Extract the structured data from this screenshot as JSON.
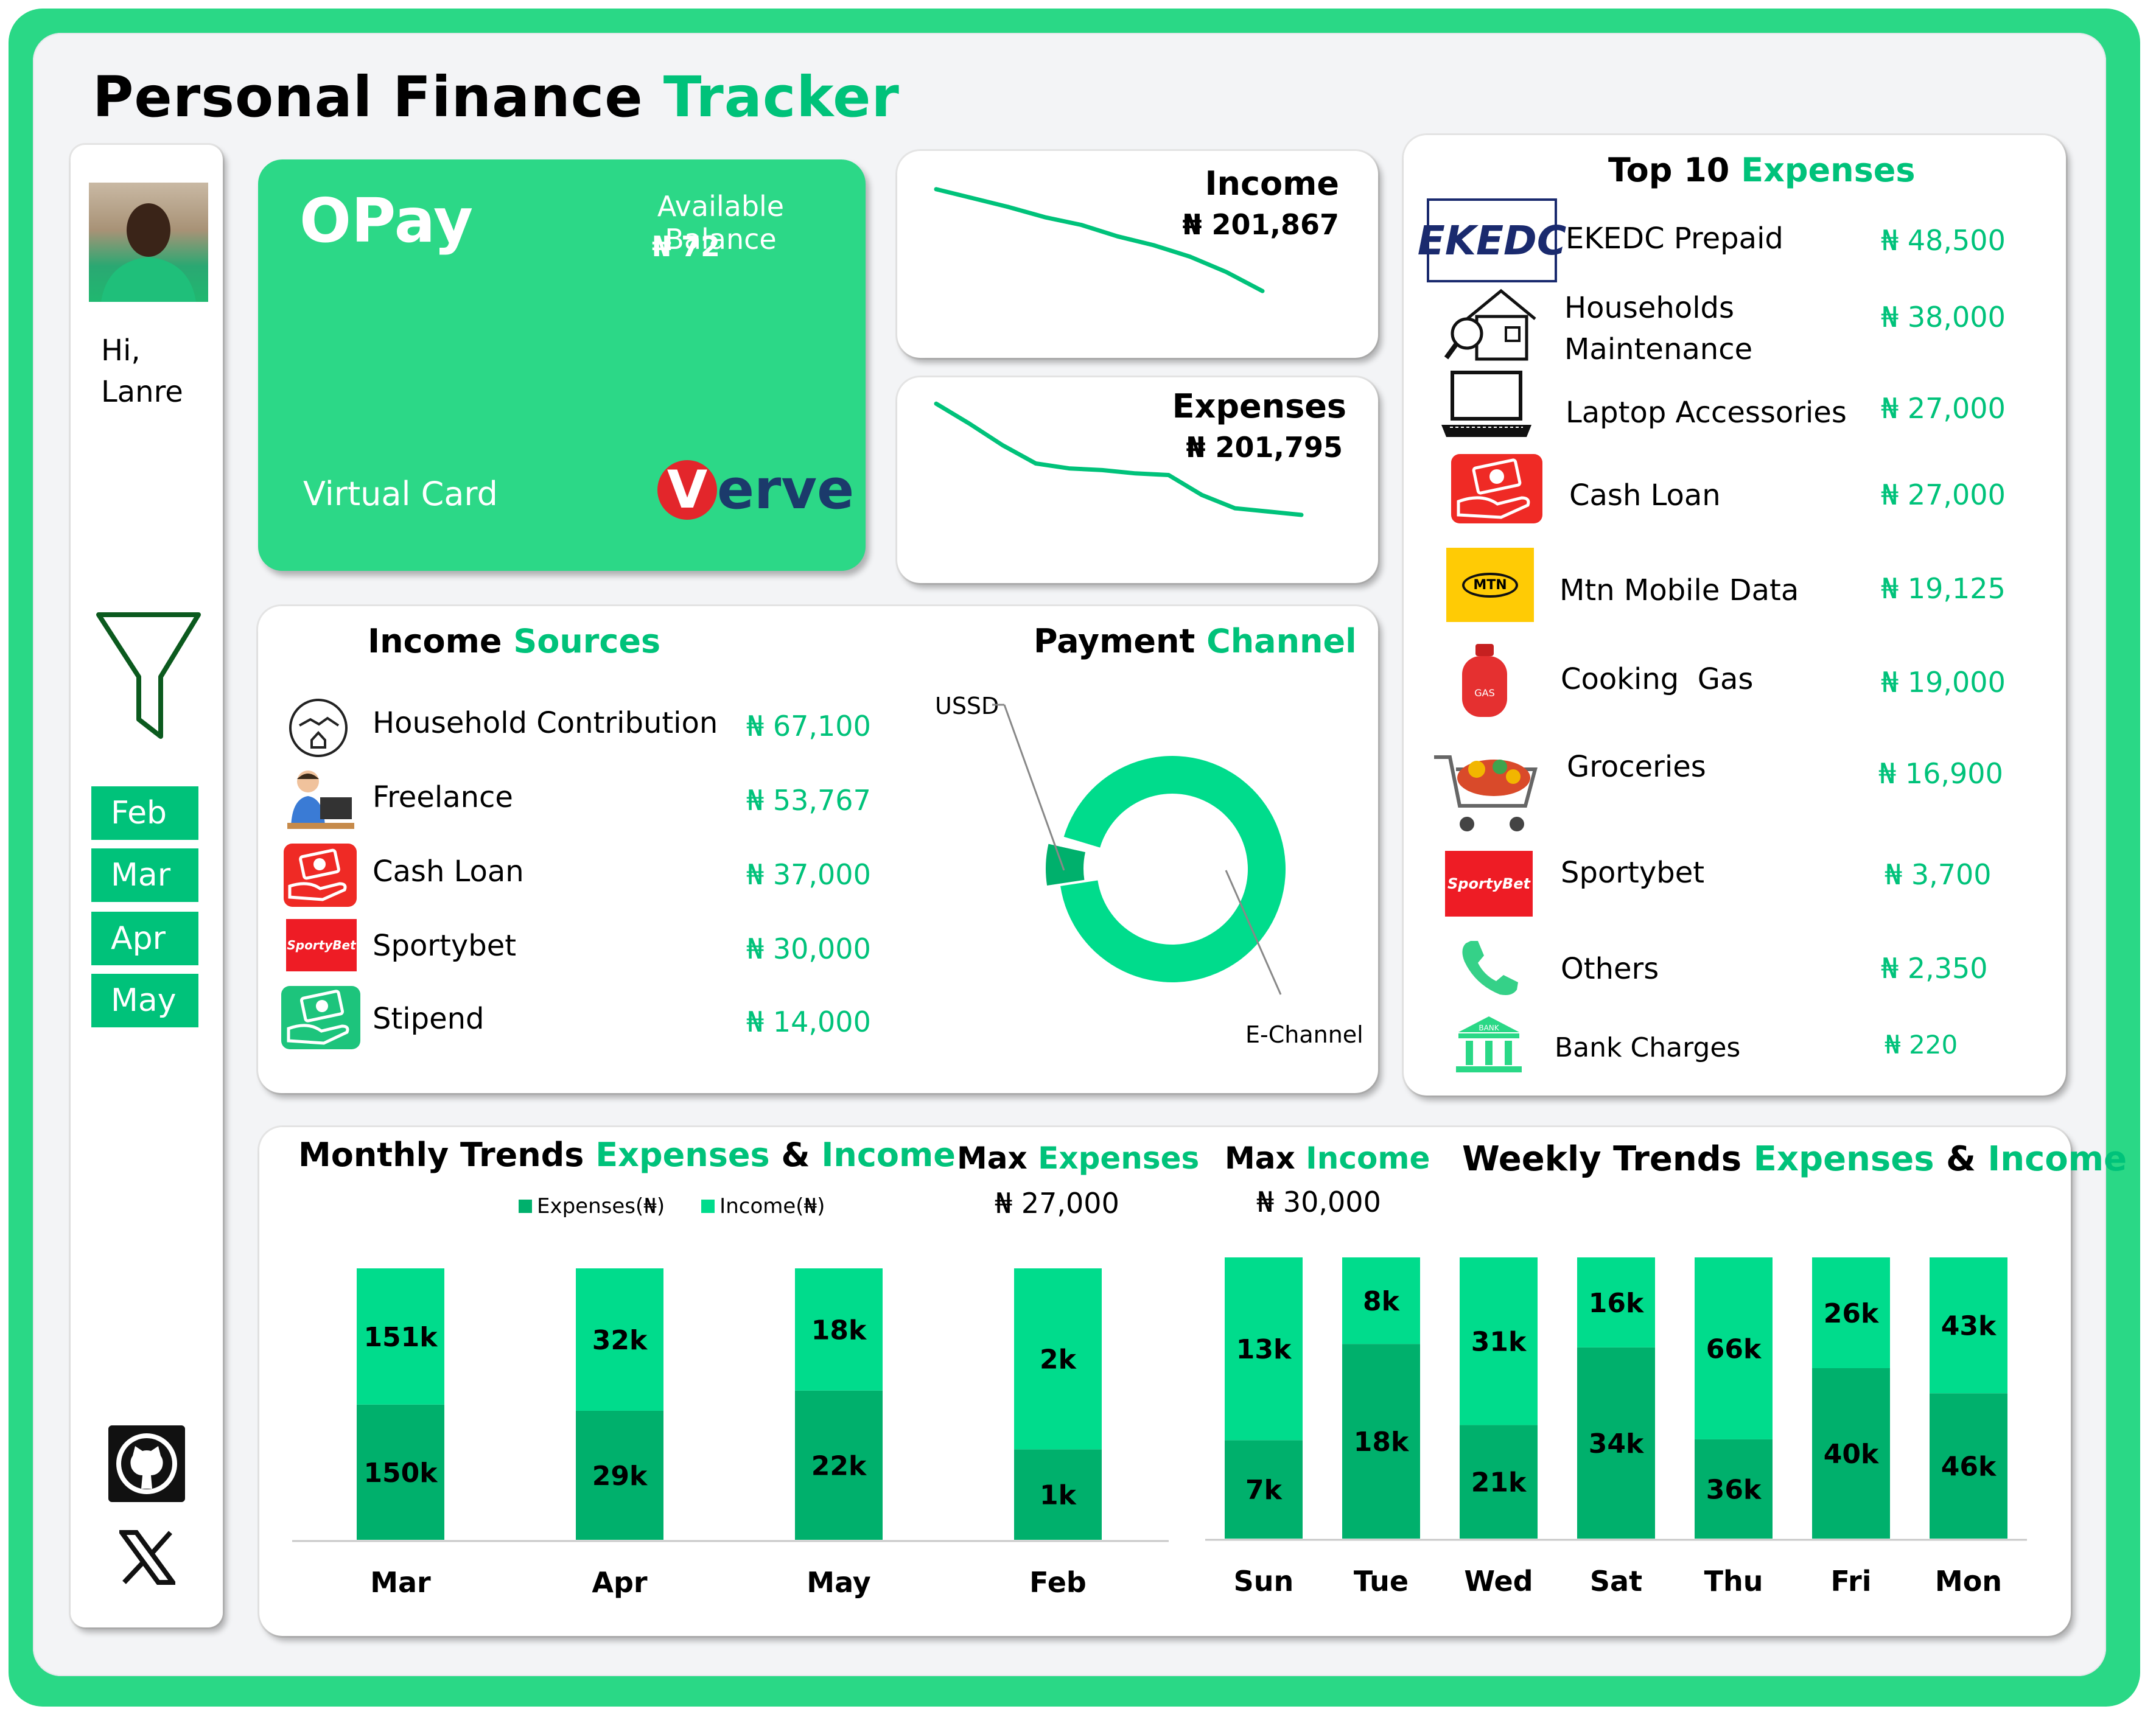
{
  "page_title": {
    "part1": "Personal Finance",
    "part2": "Tracker"
  },
  "sidebar": {
    "greeting_hi": "Hi,",
    "greeting_name": "Lanre",
    "months": [
      "Feb",
      "Mar",
      "Apr",
      "May"
    ]
  },
  "card": {
    "brand": "OPay",
    "balance_label": "Available Balance",
    "balance_value": "₦ 72",
    "card_type": "Virtual Card",
    "network": "Verve",
    "network_first": "V",
    "network_rest": "erve"
  },
  "income_kpi": {
    "label": "Income",
    "value": "₦ 201,867"
  },
  "expenses_kpi": {
    "label": "Expenses",
    "value": "₦ 201,795"
  },
  "income_sources": {
    "title1": "Income",
    "title2": "Sources",
    "items": [
      {
        "label": "Household Contribution",
        "value": "₦ 67,100",
        "icon": "handshake-house-icon"
      },
      {
        "label": "Freelance",
        "value": "₦ 53,767",
        "icon": "computer-worker-icon"
      },
      {
        "label": "Cash Loan",
        "value": "₦ 37,000",
        "icon": "cash-hand-icon"
      },
      {
        "label": "Sportybet",
        "value": "₦ 30,000",
        "icon": "sportybet-logo"
      },
      {
        "label": "Stipend",
        "value": "₦ 14,000",
        "icon": "money-hand-icon"
      }
    ]
  },
  "payment_channel": {
    "title1": "Payment",
    "title2": "Channel",
    "labels": {
      "ussd": "USSD",
      "echannel": "E-Channel"
    },
    "colors": {
      "echannel": "#00dc8c",
      "ussd": "#00b06c"
    }
  },
  "top_expenses": {
    "title1": "Top 10",
    "title2": "Expenses",
    "items": [
      {
        "label": "EKEDC Prepaid",
        "value": "₦ 48,500",
        "icon": "ekedc-logo",
        "logo_text": "EKEDC"
      },
      {
        "label": "Households",
        "label2": "Maintenance",
        "value": "₦ 38,000",
        "icon": "house-search-icon"
      },
      {
        "label": "Laptop Accessories",
        "value": "₦ 27,000",
        "icon": "laptop-icon"
      },
      {
        "label": "Cash Loan",
        "value": "₦ 27,000",
        "icon": "cash-hand-icon"
      },
      {
        "label": "Mtn Mobile Data",
        "value": "₦ 19,125",
        "icon": "mtn-logo",
        "logo_text": "MTN"
      },
      {
        "label": "Cooking  Gas",
        "value": "₦ 19,000",
        "icon": "gas-cylinder-icon"
      },
      {
        "label": "Groceries",
        "value": "₦ 16,900",
        "icon": "shopping-cart-icon"
      },
      {
        "label": "Sportybet",
        "value": "₦ 3,700",
        "icon": "sportybet-logo"
      },
      {
        "label": "Others",
        "value": "₦ 2,350",
        "icon": "phone-icon"
      },
      {
        "label": "Bank Charges",
        "value": "₦ 220",
        "icon": "bank-icon"
      }
    ]
  },
  "logo_texts": {
    "sportybet": "SportyBet",
    "gas": "GAS",
    "bank": "BANK"
  },
  "monthly": {
    "title1": "Monthly Trends",
    "title2": "Expenses",
    "amp": "&",
    "title3": "Income",
    "legend": {
      "expenses": "Expenses(₦)",
      "income": "Income(₦)"
    }
  },
  "max_expenses": {
    "label1": "Max",
    "label2": "Expenses",
    "value": "₦ 27,000"
  },
  "max_income": {
    "label1": "Max",
    "label2": "Income",
    "value": "₦ 30,000"
  },
  "weekly": {
    "title1": "Weekly Trends",
    "title2": "Expenses",
    "amp": "&",
    "title3": "Income"
  },
  "colors": {
    "accent": "#00c27a",
    "income": "#00dc8c",
    "expenses": "#00b06c",
    "frame": "#2ad886"
  },
  "chart_data": [
    {
      "type": "line",
      "name": "income_trend",
      "values": [
        100,
        93,
        86,
        78,
        72,
        63,
        56,
        47,
        35,
        20
      ],
      "ylim": [
        0,
        110
      ],
      "grid": false
    },
    {
      "type": "line",
      "name": "expenses_trend",
      "values": [
        100,
        88,
        75,
        64,
        61,
        60,
        58,
        57,
        45,
        37,
        35,
        33
      ],
      "ylim": [
        0,
        110
      ],
      "grid": false
    },
    {
      "type": "pie",
      "name": "payment_channel",
      "categories": [
        "E-Channel",
        "USSD"
      ],
      "values": [
        93,
        7
      ]
    },
    {
      "type": "bar",
      "name": "monthly_trends",
      "stacked": true,
      "categories": [
        "Mar",
        "Apr",
        "May",
        "Feb"
      ],
      "series": [
        {
          "name": "Expenses(₦)",
          "values": [
            150,
            29,
            22,
            1
          ],
          "labels": [
            "150k",
            "29k",
            "22k",
            "1k"
          ]
        },
        {
          "name": "Income(₦)",
          "values": [
            151,
            32,
            18,
            2
          ],
          "labels": [
            "151k",
            "32k",
            "18k",
            "2k"
          ]
        }
      ],
      "legend": "top"
    },
    {
      "type": "bar",
      "name": "weekly_trends",
      "stacked": true,
      "categories": [
        "Sun",
        "Tue",
        "Wed",
        "Sat",
        "Thu",
        "Fri",
        "Mon"
      ],
      "series": [
        {
          "name": "Expenses",
          "values": [
            7,
            18,
            21,
            34,
            36,
            40,
            46
          ],
          "labels": [
            "7k",
            "18k",
            "21k",
            "34k",
            "36k",
            "40k",
            "46k"
          ]
        },
        {
          "name": "Income",
          "values": [
            13,
            8,
            31,
            16,
            66,
            26,
            43
          ],
          "labels": [
            "13k",
            "8k",
            "31k",
            "16k",
            "66k",
            "26k",
            "43k"
          ]
        }
      ]
    }
  ]
}
